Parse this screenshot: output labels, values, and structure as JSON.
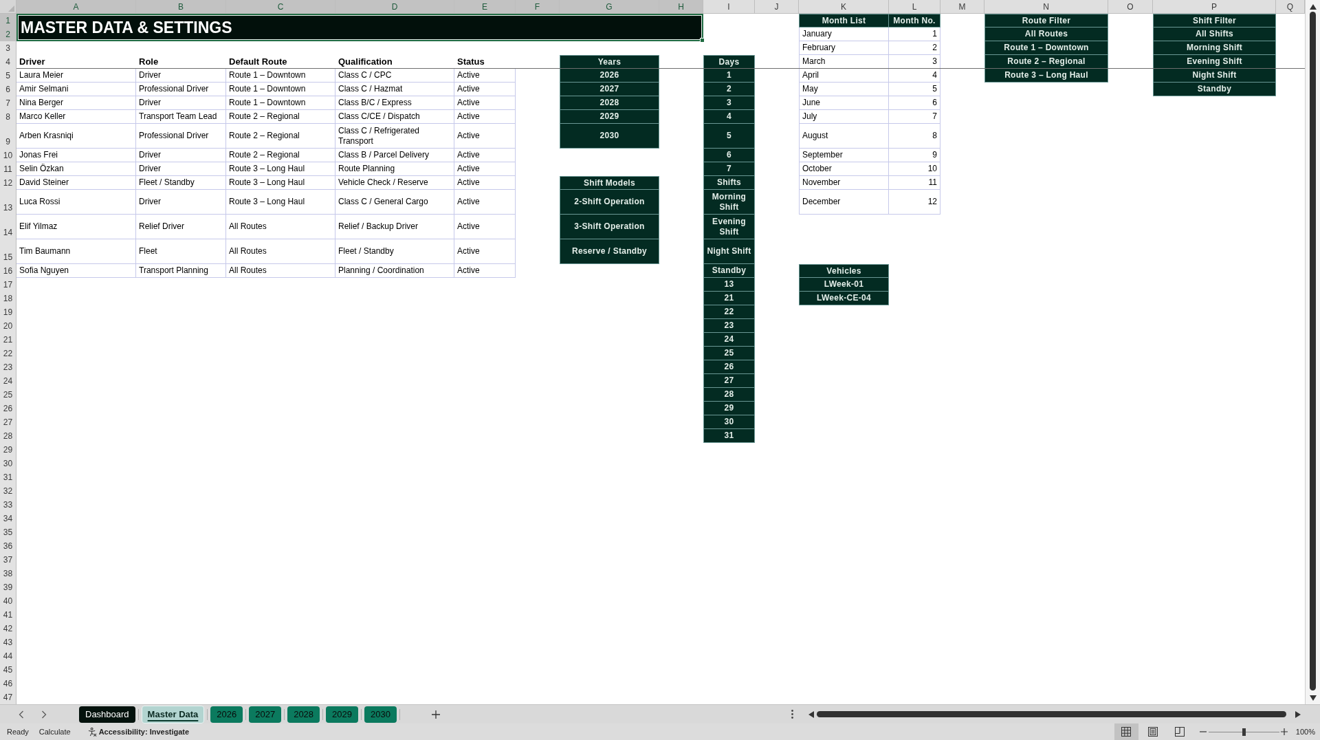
{
  "column_headers": [
    {
      "label": "A",
      "selected": true
    },
    {
      "label": "B",
      "selected": true
    },
    {
      "label": "C",
      "selected": true
    },
    {
      "label": "D",
      "selected": true
    },
    {
      "label": "E",
      "selected": true
    },
    {
      "label": "F",
      "selected": true
    },
    {
      "label": "G",
      "selected": true
    },
    {
      "label": "H",
      "selected": true
    },
    {
      "label": "I",
      "selected": false
    },
    {
      "label": "J",
      "selected": false
    },
    {
      "label": "K",
      "selected": false
    },
    {
      "label": "L",
      "selected": false
    },
    {
      "label": "M",
      "selected": false
    },
    {
      "label": "N",
      "selected": false
    },
    {
      "label": "O",
      "selected": false
    },
    {
      "label": "P",
      "selected": false
    },
    {
      "label": "Q",
      "selected": false
    }
  ],
  "row_headers": [
    {
      "label": "1",
      "selected": true
    },
    {
      "label": "2",
      "selected": true
    },
    {
      "label": "3",
      "selected": false
    },
    {
      "label": "4",
      "selected": false
    },
    {
      "label": "5",
      "selected": false
    },
    {
      "label": "6",
      "selected": false
    },
    {
      "label": "7",
      "selected": false
    },
    {
      "label": "8",
      "selected": false
    },
    {
      "label": "9",
      "selected": false
    },
    {
      "label": "10",
      "selected": false
    },
    {
      "label": "11",
      "selected": false
    },
    {
      "label": "12",
      "selected": false
    },
    {
      "label": "13",
      "selected": false
    },
    {
      "label": "14",
      "selected": false
    },
    {
      "label": "15",
      "selected": false
    },
    {
      "label": "16",
      "selected": false
    },
    {
      "label": "17",
      "selected": false
    },
    {
      "label": "18",
      "selected": false
    },
    {
      "label": "19",
      "selected": false
    },
    {
      "label": "20",
      "selected": false
    },
    {
      "label": "21",
      "selected": false
    },
    {
      "label": "22",
      "selected": false
    },
    {
      "label": "23",
      "selected": false
    },
    {
      "label": "24",
      "selected": false
    },
    {
      "label": "25",
      "selected": false
    },
    {
      "label": "26",
      "selected": false
    },
    {
      "label": "27",
      "selected": false
    },
    {
      "label": "28",
      "selected": false
    },
    {
      "label": "29",
      "selected": false
    },
    {
      "label": "30",
      "selected": false
    },
    {
      "label": "31",
      "selected": false
    },
    {
      "label": "32",
      "selected": false
    },
    {
      "label": "33",
      "selected": false
    },
    {
      "label": "34",
      "selected": false
    },
    {
      "label": "35",
      "selected": false
    },
    {
      "label": "36",
      "selected": false
    },
    {
      "label": "37",
      "selected": false
    },
    {
      "label": "38",
      "selected": false
    },
    {
      "label": "39",
      "selected": false
    },
    {
      "label": "40",
      "selected": false
    },
    {
      "label": "41",
      "selected": false
    },
    {
      "label": "42",
      "selected": false
    },
    {
      "label": "43",
      "selected": false
    },
    {
      "label": "44",
      "selected": false
    },
    {
      "label": "45",
      "selected": false
    },
    {
      "label": "46",
      "selected": false
    },
    {
      "label": "47",
      "selected": false
    }
  ],
  "title": "MASTER DATA & SETTINGS",
  "drivers": {
    "columns": [
      "Driver",
      "Role",
      "Default Route",
      "Qualification",
      "Status"
    ],
    "rows": [
      [
        "Laura Meier",
        "Driver",
        "Route 1 – Downtown",
        "Class C / CPC",
        "Active"
      ],
      [
        "Amir Selmani",
        "Professional Driver",
        "Route 1 – Downtown",
        "Class C / Hazmat",
        "Active"
      ],
      [
        "Nina Berger",
        "Driver",
        "Route 1 – Downtown",
        "Class B/C / Express",
        "Active"
      ],
      [
        "Marco Keller",
        "Transport Team Lead",
        "Route 2 – Regional",
        "Class C/CE / Dispatch",
        "Active"
      ],
      [
        "Arben Krasniqi",
        "Professional Driver",
        "Route 2 – Regional",
        "Class C / Refrigerated Transport",
        "Active"
      ],
      [
        "Jonas Frei",
        "Driver",
        "Route 2 – Regional",
        "Class B / Parcel Delivery",
        "Active"
      ],
      [
        "Selin Özkan",
        "Driver",
        "Route 3 – Long Haul",
        "Route Planning",
        "Active"
      ],
      [
        "David Steiner",
        "Fleet / Standby",
        "Route 3 – Long Haul",
        "Vehicle Check / Reserve",
        "Active"
      ],
      [
        "Luca Rossi",
        "Driver",
        "Route 3 – Long Haul",
        "Class C / General Cargo",
        "Active"
      ],
      [
        "Elif Yilmaz",
        "Relief Driver",
        "All Routes",
        "Relief / Backup Driver",
        "Active"
      ],
      [
        "Tim Baumann",
        "Fleet",
        "All Routes",
        "Fleet / Standby",
        "Active"
      ],
      [
        "Sofia Nguyen",
        "Transport Planning",
        "All Routes",
        "Planning / Coordination",
        "Active"
      ]
    ]
  },
  "years": {
    "header": "Years",
    "items": [
      "2026",
      "2027",
      "2028",
      "2029",
      "2030"
    ]
  },
  "shift_models": {
    "header": "Shift Models",
    "items": [
      "2-Shift Operation",
      "3-Shift Operation",
      "Reserve / Standby"
    ]
  },
  "days": {
    "header": "Days",
    "items": [
      "1",
      "2",
      "3",
      "4",
      "5",
      "6",
      "7",
      "Shifts",
      "Morning Shift",
      "Evening Shift",
      "Night Shift",
      "Standby",
      "13",
      "21",
      "22",
      "23",
      "24",
      "25",
      "26",
      "27",
      "28",
      "29",
      "30",
      "31"
    ]
  },
  "months": {
    "columns": [
      "Month List",
      "Month No."
    ],
    "rows": [
      [
        "January",
        "1"
      ],
      [
        "February",
        "2"
      ],
      [
        "March",
        "3"
      ],
      [
        "April",
        "4"
      ],
      [
        "May",
        "5"
      ],
      [
        "June",
        "6"
      ],
      [
        "July",
        "7"
      ],
      [
        "August",
        "8"
      ],
      [
        "September",
        "9"
      ],
      [
        "October",
        "10"
      ],
      [
        "November",
        "11"
      ],
      [
        "December",
        "12"
      ]
    ]
  },
  "vehicles": {
    "header": "Vehicles",
    "items": [
      "LWeek-01",
      "LWeek-CE-04"
    ]
  },
  "route_filter": {
    "header": "Route Filter",
    "items": [
      "All Routes",
      "Route 1 – Downtown",
      "Route 2 – Regional",
      "Route 3 – Long Haul"
    ]
  },
  "shift_filter": {
    "header": "Shift Filter",
    "items": [
      "All Shifts",
      "Morning Shift",
      "Evening Shift",
      "Night Shift",
      "Standby"
    ]
  },
  "sheet_tabs": [
    {
      "label": "Dashboard",
      "selected": false,
      "color": "#04120d"
    },
    {
      "label": "Master Data",
      "selected": true,
      "color": "#b2d4d0"
    },
    {
      "label": "2026",
      "selected": false,
      "color": "#0b7a5e"
    },
    {
      "label": "2027",
      "selected": false,
      "color": "#0b7a5e"
    },
    {
      "label": "2028",
      "selected": false,
      "color": "#0b7a5e"
    },
    {
      "label": "2029",
      "selected": false,
      "color": "#0b7a5e"
    },
    {
      "label": "2030",
      "selected": false,
      "color": "#0b7a5e"
    }
  ],
  "status_bar": {
    "mode": "Ready",
    "calculate": "Calculate",
    "accessibility": "Accessibility: Investigate",
    "views": [
      {
        "kind": "normal",
        "selected": true
      },
      {
        "kind": "page_layout",
        "selected": false
      },
      {
        "kind": "page_break",
        "selected": false
      }
    ],
    "zoom": {
      "level": 0.5
    },
    "zoom_label": "100%"
  }
}
